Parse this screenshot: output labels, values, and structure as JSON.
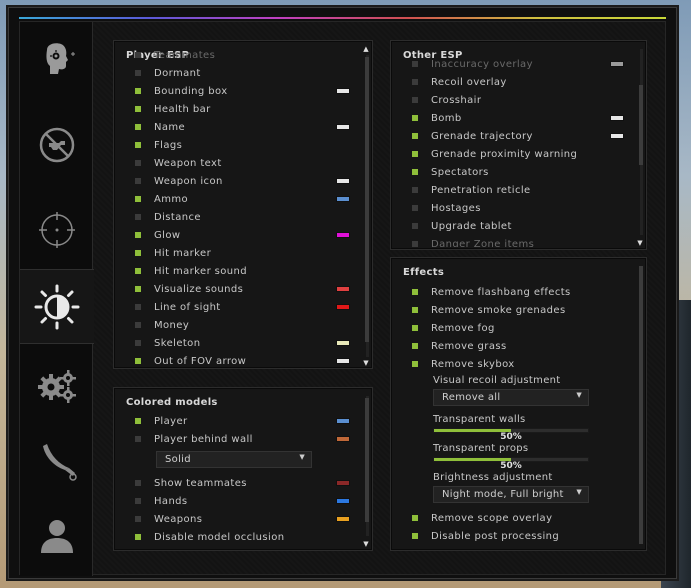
{
  "tabs": [
    {
      "icon": "crosshair-head-icon"
    },
    {
      "icon": "no-symbol-icon"
    },
    {
      "icon": "crosshair-icon"
    },
    {
      "icon": "brightness-icon"
    },
    {
      "icon": "gears-icon"
    },
    {
      "icon": "knife-icon"
    },
    {
      "icon": "user-icon"
    }
  ],
  "player_esp": {
    "title": "Player ESP",
    "items": [
      {
        "label": "Teammates",
        "on": false,
        "color": null,
        "faded": true
      },
      {
        "label": "Dormant",
        "on": false,
        "color": null
      },
      {
        "label": "Bounding box",
        "on": true,
        "color": "#e6e6e6"
      },
      {
        "label": "Health bar",
        "on": true,
        "color": null
      },
      {
        "label": "Name",
        "on": true,
        "color": "#e6e6e6"
      },
      {
        "label": "Flags",
        "on": true,
        "color": null
      },
      {
        "label": "Weapon text",
        "on": false,
        "color": null
      },
      {
        "label": "Weapon icon",
        "on": false,
        "color": "#e6e6e6"
      },
      {
        "label": "Ammo",
        "on": true,
        "color": "#5b8fd0"
      },
      {
        "label": "Distance",
        "on": false,
        "color": null
      },
      {
        "label": "Glow",
        "on": true,
        "color": "#e010d8"
      },
      {
        "label": "Hit marker",
        "on": true,
        "color": null
      },
      {
        "label": "Hit marker sound",
        "on": true,
        "color": null
      },
      {
        "label": "Visualize sounds",
        "on": true,
        "color": "#e04040"
      },
      {
        "label": "Line of sight",
        "on": false,
        "color": "#e01818"
      },
      {
        "label": "Money",
        "on": false,
        "color": null
      },
      {
        "label": "Skeleton",
        "on": false,
        "color": "#e8e8b8"
      },
      {
        "label": "Out of FOV arrow",
        "on": true,
        "color": "#e6e6e6"
      }
    ]
  },
  "colored_models": {
    "title": "Colored models",
    "items": [
      {
        "label": "Player",
        "on": true,
        "color": "#5b8fd0"
      },
      {
        "label": "Player behind wall",
        "on": false,
        "color": "#c06838"
      }
    ],
    "material_select": "Solid",
    "items2": [
      {
        "label": "Show teammates",
        "on": false,
        "color": "#8a2828"
      },
      {
        "label": "Hands",
        "on": false,
        "color": "#2c78e0"
      },
      {
        "label": "Weapons",
        "on": false,
        "color": "#e8a020"
      },
      {
        "label": "Disable model occlusion",
        "on": true,
        "color": null
      }
    ]
  },
  "other_esp": {
    "title": "Other ESP",
    "items": [
      {
        "label": "Inaccuracy overlay",
        "on": false,
        "color": "#9a9a9a",
        "faded": true
      },
      {
        "label": "Recoil overlay",
        "on": false,
        "color": null
      },
      {
        "label": "Crosshair",
        "on": false,
        "color": null
      },
      {
        "label": "Bomb",
        "on": true,
        "color": "#e6e6e6"
      },
      {
        "label": "Grenade trajectory",
        "on": true,
        "color": "#e6e6e6"
      },
      {
        "label": "Grenade proximity warning",
        "on": true,
        "color": null
      },
      {
        "label": "Spectators",
        "on": true,
        "color": null
      },
      {
        "label": "Penetration reticle",
        "on": false,
        "color": null
      },
      {
        "label": "Hostages",
        "on": false,
        "color": null
      },
      {
        "label": "Upgrade tablet",
        "on": false,
        "color": null
      },
      {
        "label": "Danger Zone items",
        "on": false,
        "color": null,
        "faded": true
      }
    ]
  },
  "effects": {
    "title": "Effects",
    "items": [
      {
        "label": "Remove flashbang effects",
        "on": true
      },
      {
        "label": "Remove smoke grenades",
        "on": true
      },
      {
        "label": "Remove fog",
        "on": true
      },
      {
        "label": "Remove grass",
        "on": true
      },
      {
        "label": "Remove skybox",
        "on": true
      }
    ],
    "visual_recoil_label": "Visual recoil adjustment",
    "visual_recoil_value": "Remove all",
    "transparent_walls_label": "Transparent walls",
    "transparent_walls_value": "50%",
    "transparent_walls_level": 0.5,
    "transparent_props_label": "Transparent props",
    "transparent_props_value": "50%",
    "transparent_props_level": 0.5,
    "brightness_label": "Brightness adjustment",
    "brightness_value": "Night mode, Full bright",
    "items2": [
      {
        "label": "Remove scope overlay",
        "on": true
      },
      {
        "label": "Disable post processing",
        "on": true
      }
    ]
  }
}
